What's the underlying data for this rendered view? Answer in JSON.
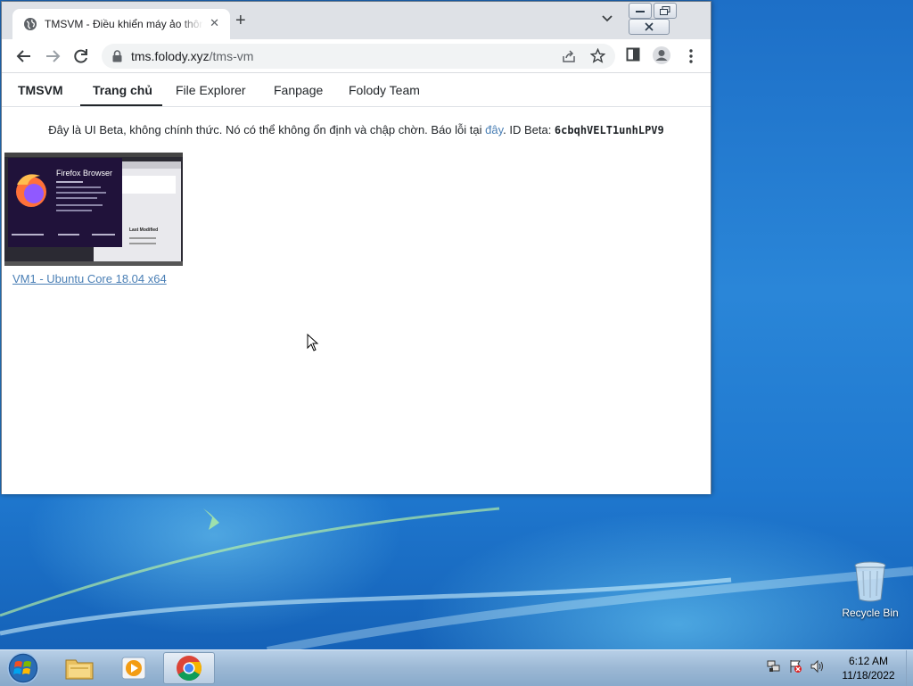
{
  "desktop": {
    "recycle_bin_label": "Recycle Bin"
  },
  "browser": {
    "tab_title": "TMSVM - Điều khiển máy ảo thông",
    "url_host": "tms.folody.xyz",
    "url_path": "/tms-vm"
  },
  "site": {
    "brand": "TMSVM",
    "nav": [
      "Trang chủ",
      "File Explorer",
      "Fanpage",
      "Folody Team"
    ],
    "active_nav": "Trang chủ",
    "notice": {
      "prefix": "Đây là UI Beta, không chính thức. Nó có thể không ổn định và chập chờn. Báo lỗi tại ",
      "link": "đây",
      "mid": ". ID Beta: ",
      "beta_id": "6cbqhVELT1unhLPV9"
    },
    "vms": [
      {
        "name": "VM1 - Ubuntu Core 18.04 x64",
        "thumb_title": "Firefox Browser",
        "thumb_label": "Last Modified"
      }
    ]
  },
  "taskbar": {
    "time": "6:12 AM",
    "date": "11/18/2022"
  },
  "colors": {
    "link": "#4a7fb5",
    "tabstrip": "#dee1e6",
    "omnibox": "#f1f3f4"
  }
}
